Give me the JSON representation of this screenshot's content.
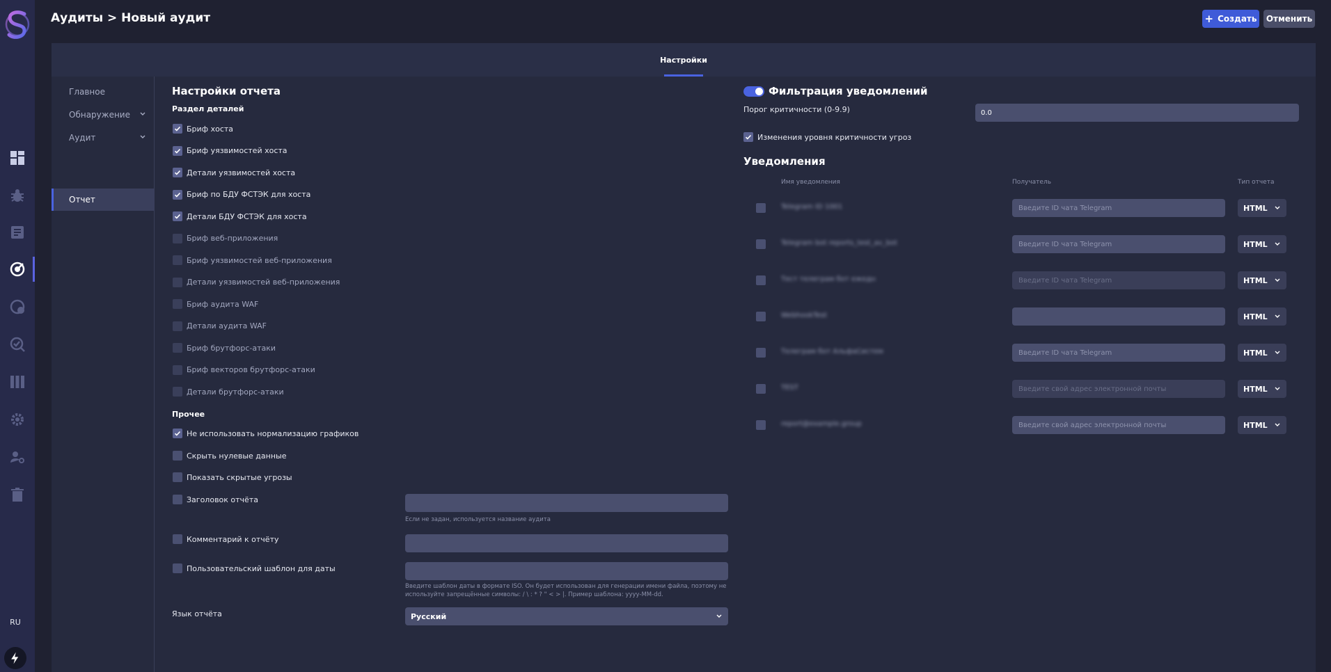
{
  "header": {
    "title": "Аудиты > Новый аудит",
    "create_label": "Создать",
    "cancel_label": "Отменить"
  },
  "tabs": [
    {
      "label": "Настройки",
      "active": true
    }
  ],
  "subnav": [
    {
      "label": "Главное"
    },
    {
      "label": "Обнаружение",
      "has_chevron": true
    },
    {
      "label": "Аудит",
      "has_chevron": true
    },
    {
      "label": "Отчет",
      "active": true
    }
  ],
  "sidebar": {
    "lang": "RU",
    "icons": [
      "dashboard-icon",
      "bug-icon",
      "document-icon",
      "audit-icon",
      "scan-icon",
      "check-icon",
      "columns-icon",
      "gear-icon",
      "user-gear-icon",
      "trash-icon"
    ]
  },
  "report": {
    "title": "Настройки отчета",
    "details_heading": "Раздел деталей",
    "details": [
      {
        "label": "Бриф хоста",
        "checked": true
      },
      {
        "label": "Бриф уязвимостей хоста",
        "checked": true
      },
      {
        "label": "Детали уязвимостей хоста",
        "checked": true
      },
      {
        "label": "Бриф по БДУ ФСТЭК для хоста",
        "checked": true
      },
      {
        "label": "Детали БДУ ФСТЭК для хоста",
        "checked": true
      },
      {
        "label": "Бриф веб-приложения",
        "checked": false
      },
      {
        "label": "Бриф уязвимостей веб-приложения",
        "checked": false
      },
      {
        "label": "Детали уязвимостей веб-приложения",
        "checked": false
      },
      {
        "label": "Бриф аудита WAF",
        "checked": false
      },
      {
        "label": "Детали аудита WAF",
        "checked": false
      },
      {
        "label": "Бриф брутфорс-атаки",
        "checked": false
      },
      {
        "label": "Бриф векторов брутфорс-атаки",
        "checked": false
      },
      {
        "label": "Детали брутфорс-атаки",
        "checked": false
      }
    ],
    "other_heading": "Прочее",
    "other": [
      {
        "label": "Не использовать нормализацию графиков",
        "checked": true
      },
      {
        "label": "Скрыть нулевые данные",
        "checked": false
      },
      {
        "label": "Показать скрытые угрозы",
        "checked": false
      },
      {
        "label": "Заголовок отчёта",
        "checked": false
      },
      {
        "label": "Комментарий к отчёту",
        "checked": false
      },
      {
        "label": "Пользовательский шаблон для даты",
        "checked": false
      }
    ],
    "title_hint": "Если не задан, используется название аудита",
    "date_hint_1": "Введите шаблон даты в формате ISO. Он будет использован для генерации имени файла, поэтому не",
    "date_hint_2": "используйте запрещённые символы: / \\ : * ? \" < > |. Пример шаблона: yyyy-MM-dd.",
    "language_label": "Язык отчёта",
    "language_value": "Русский"
  },
  "filter": {
    "title": "Фильтрация уведомлений",
    "enabled": true,
    "threshold_label": "Порог критичности (0-9.9)",
    "threshold_value": "0.0",
    "changes_label": "Изменения уровня критичности угроз",
    "changes_checked": true
  },
  "notifications": {
    "title": "Уведомления",
    "col_name": "Имя уведомления",
    "col_recipient": "Получатель",
    "col_type": "Тип отчета",
    "rows": [
      {
        "name": "Telegram ID 1001",
        "placeholder": "Введите ID чата Telegram",
        "type": "HTML",
        "dim": false
      },
      {
        "name": "Telegram bot reports_test_av_bot",
        "placeholder": "Введите ID чата Telegram",
        "type": "HTML",
        "dim": false
      },
      {
        "name": "Тест телеграм бот ежедн",
        "placeholder": "Введите ID чата Telegram",
        "type": "HTML",
        "dim": true
      },
      {
        "name": "WebhookTest",
        "placeholder": "",
        "type": "HTML",
        "dim": false
      },
      {
        "name": "Телеграм бот АльфаСистем",
        "placeholder": "Введите ID чата Telegram",
        "type": "HTML",
        "dim": false
      },
      {
        "name": "TEST",
        "placeholder": "Введите свой адрес электронной почты",
        "type": "HTML",
        "dim": true
      },
      {
        "name": "report@example.group",
        "placeholder": "Введите свой адрес электронной почты",
        "type": "HTML",
        "dim": false
      }
    ]
  },
  "colors": {
    "accent": "#4a63e0",
    "background": "#1f2131",
    "panel": "#262a3e"
  }
}
